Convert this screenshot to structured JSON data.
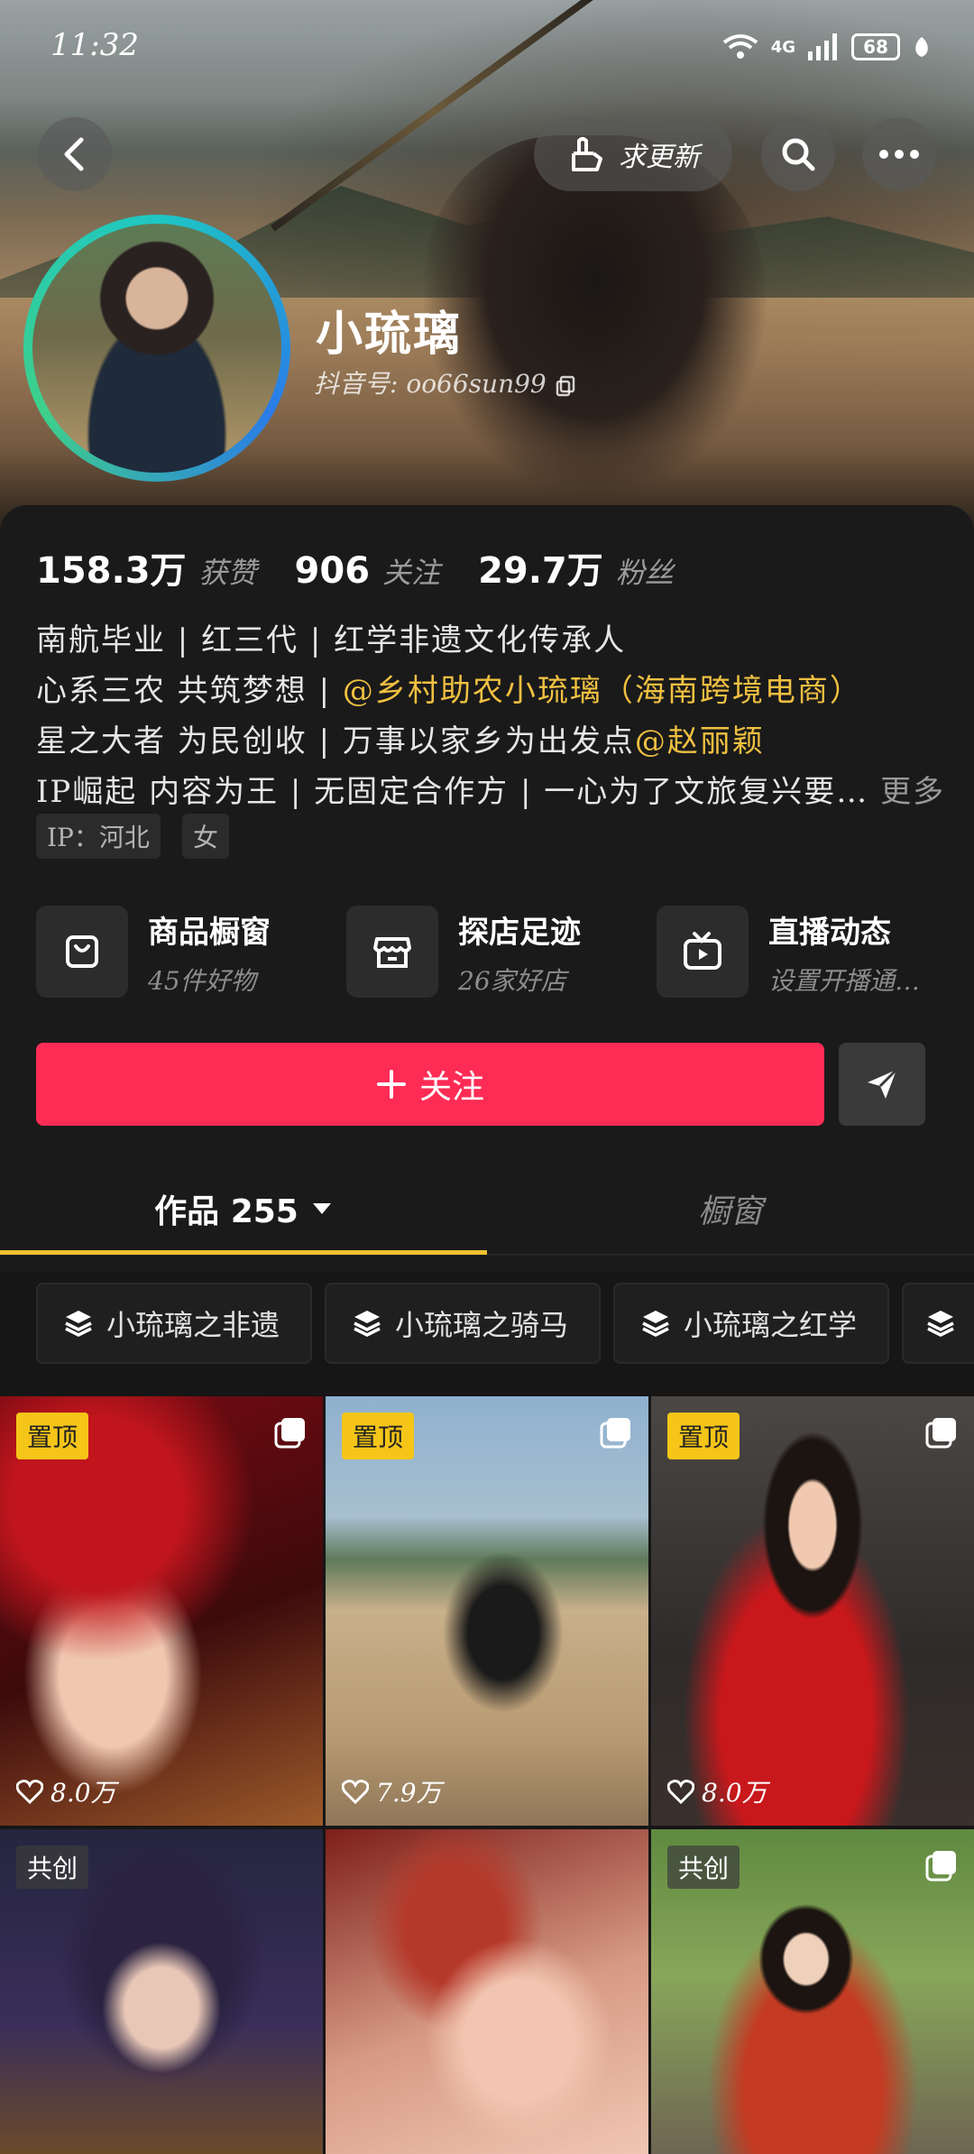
{
  "status": {
    "time": "11:32",
    "network": "4G",
    "battery": "68"
  },
  "header": {
    "update_button": "求更新"
  },
  "profile": {
    "name": "小琉璃",
    "douyin_id": "抖音号: oo66sun99",
    "stats": {
      "likes_num": "158.3万",
      "likes_label": "获赞",
      "following_num": "906",
      "following_label": "关注",
      "fans_num": "29.7万",
      "fans_label": "粉丝"
    },
    "bio": {
      "line1": "南航毕业 | 红三代 | 红学非遗文化传承人",
      "line2_pre": "心系三农 共筑梦想 | ",
      "line2_link": "@乡村助农小琉璃（海南跨境电商）",
      "line3_pre": "星之大者 为民创收 | 万事以家乡为出发点",
      "line3_link": "@赵丽颖",
      "line4": "IP崛起 内容为王 | 无固定合作方 | 一心为了文旅复兴要…",
      "more": "更多"
    },
    "tags": [
      "IP：河北",
      "女"
    ]
  },
  "shortcuts": [
    {
      "title": "商品橱窗",
      "sub": "45件好物"
    },
    {
      "title": "探店足迹",
      "sub": "26家好店"
    },
    {
      "title": "直播动态",
      "sub": "设置开播通…"
    }
  ],
  "actions": {
    "follow": "关注"
  },
  "tabs": {
    "works": "作品 255",
    "window": "橱窗"
  },
  "collections": [
    "小琉璃之非遗",
    "小琉璃之骑马",
    "小琉璃之红学"
  ],
  "posts": [
    {
      "badge": "置顶",
      "likes": "8.0万"
    },
    {
      "badge": "置顶",
      "likes": "7.9万"
    },
    {
      "badge": "置顶",
      "likes": "8.0万"
    },
    {
      "badge": "共创"
    },
    {
      "badge": ""
    },
    {
      "badge": "共创"
    }
  ],
  "colors": {
    "accent": "#fe2c55",
    "highlight": "#f0c040",
    "tab_underline": "#f2c230"
  }
}
